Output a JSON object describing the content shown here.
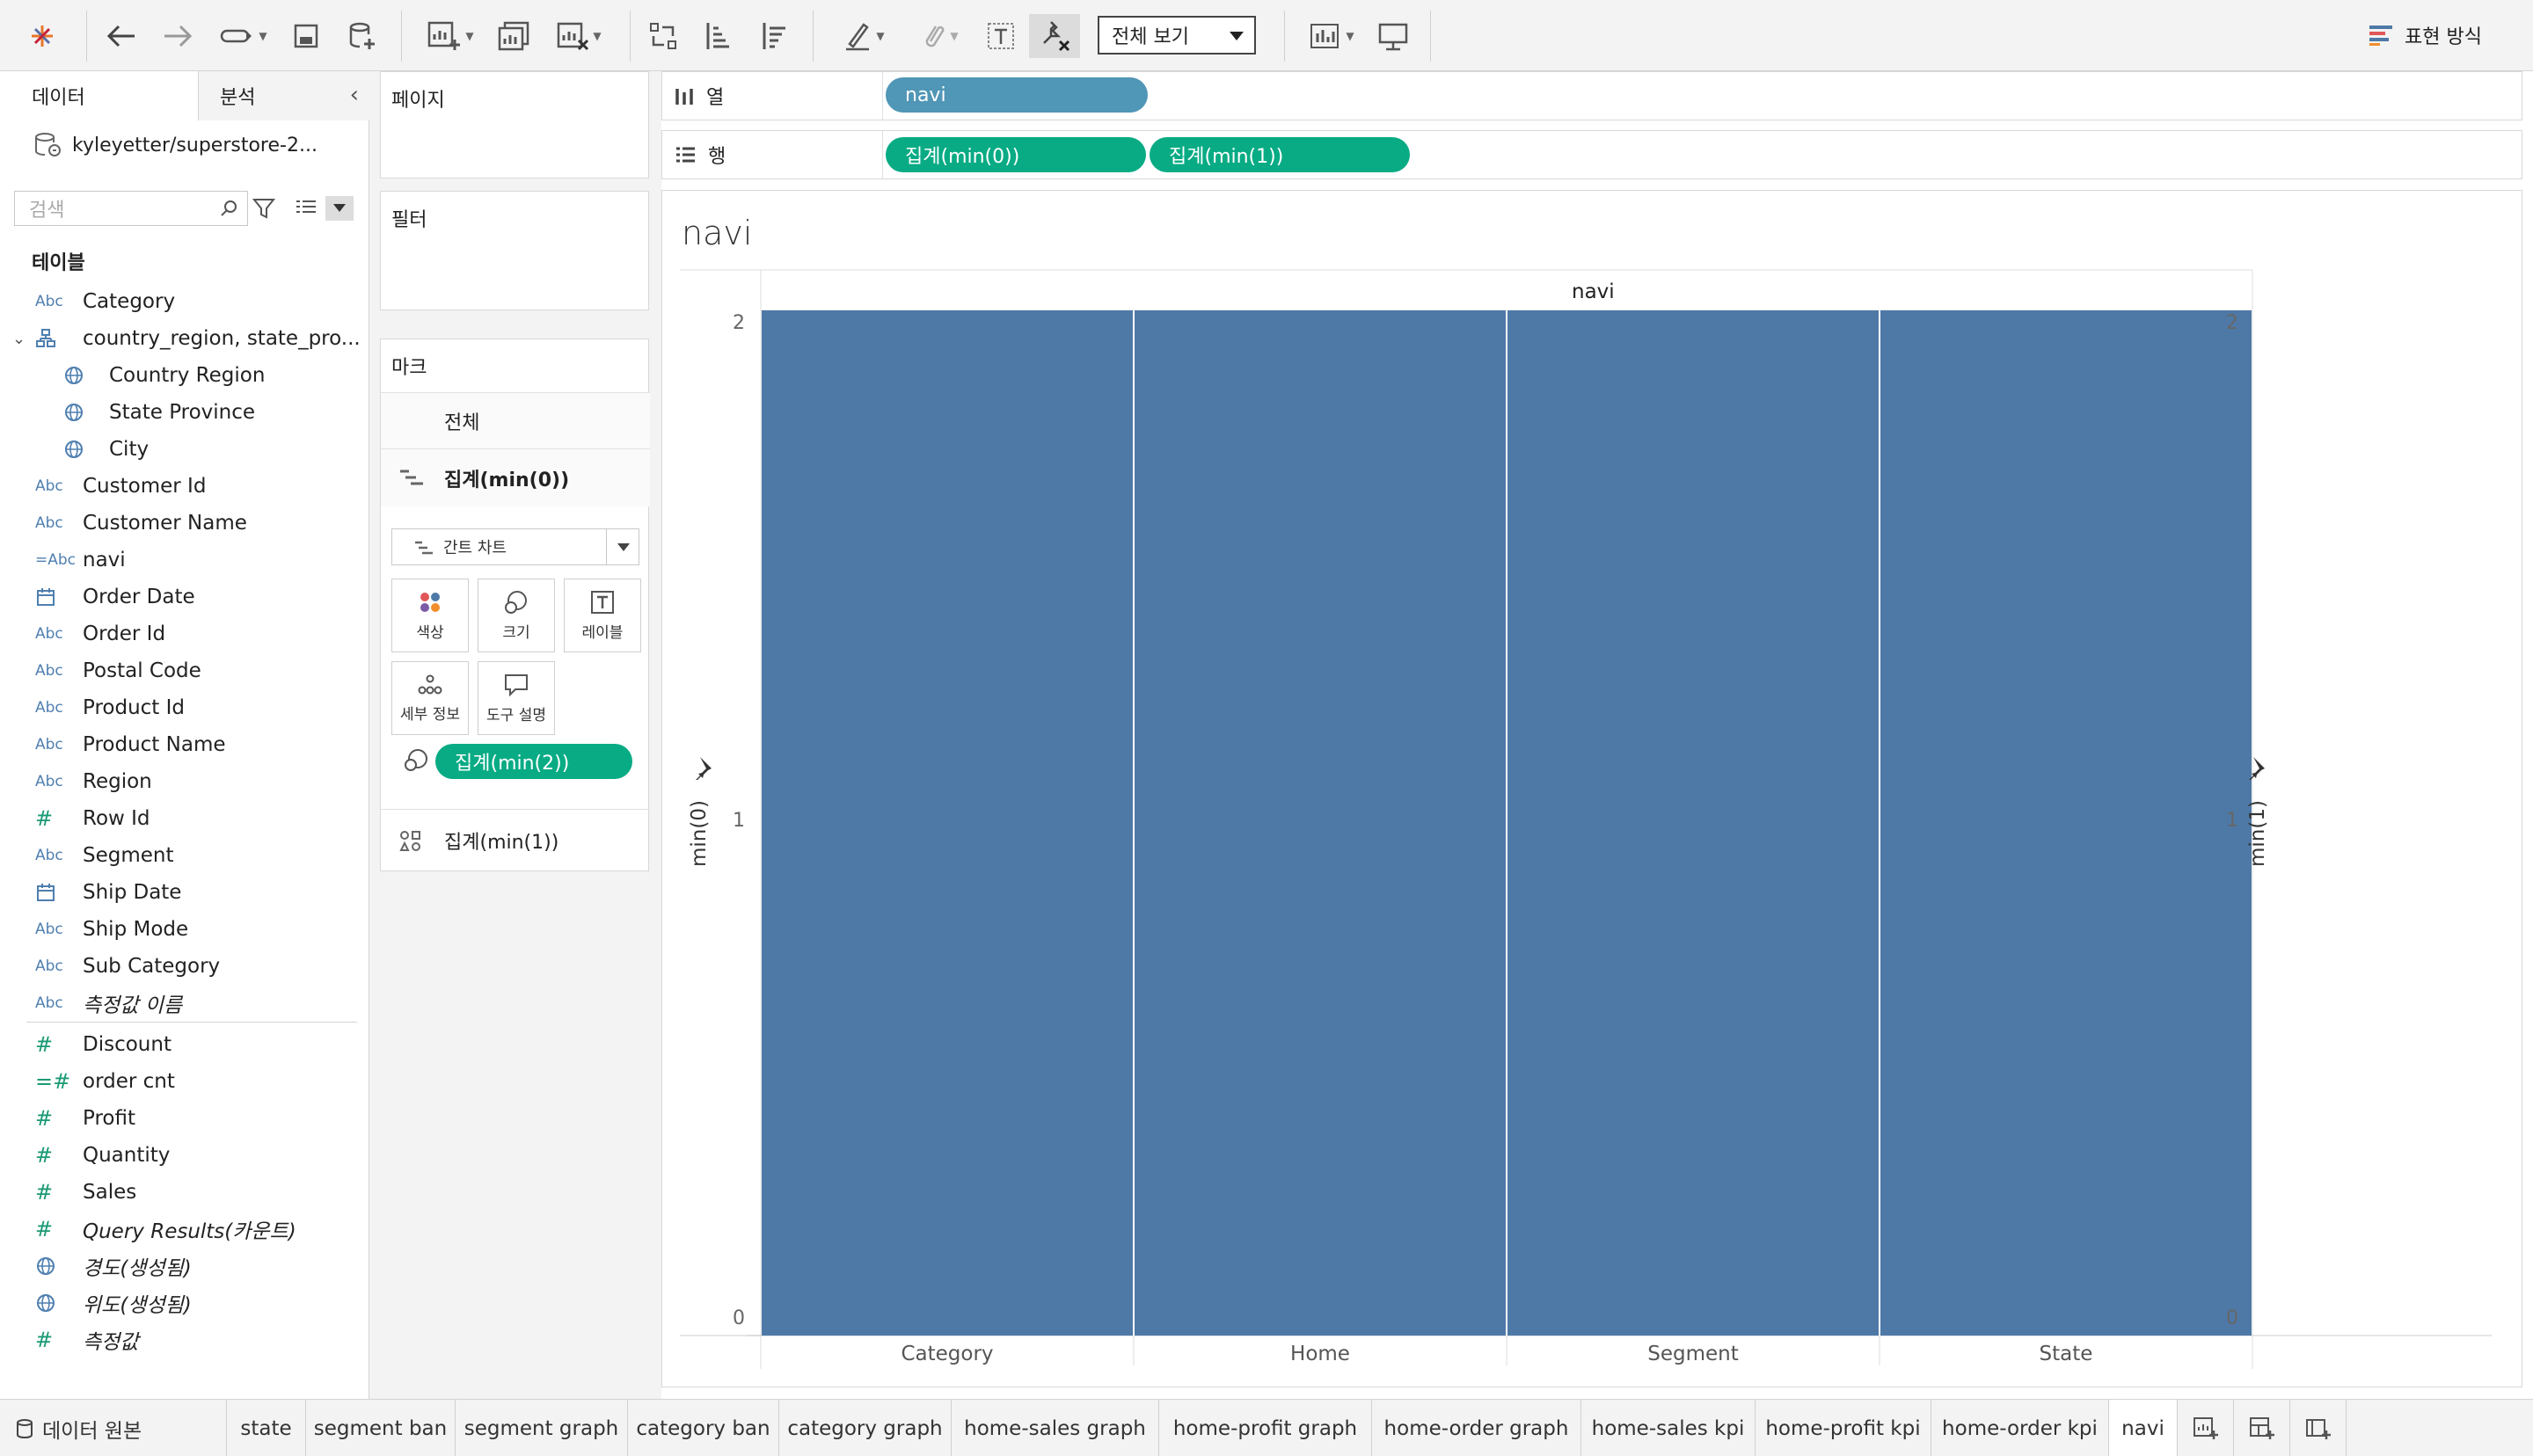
{
  "toolbar": {
    "view_select": "전체 보기",
    "show_me": "표현 방식"
  },
  "data_pane": {
    "tab_data": "데이터",
    "tab_analysis": "분석",
    "datasource": "kyleyetter/superstore-2...",
    "search_placeholder": "검색",
    "tables_heading": "테이블",
    "fields": [
      {
        "icon": "Abc",
        "name": "Category"
      },
      {
        "icon": "hierarchy",
        "name": "country_region, state_pro..."
      },
      {
        "icon": "globe",
        "name": "Country Region"
      },
      {
        "icon": "globe",
        "name": "State Province"
      },
      {
        "icon": "globe",
        "name": "City"
      },
      {
        "icon": "Abc",
        "name": "Customer Id"
      },
      {
        "icon": "Abc",
        "name": "Customer Name"
      },
      {
        "icon": "=Abc",
        "name": "navi"
      },
      {
        "icon": "calendar",
        "name": "Order Date"
      },
      {
        "icon": "Abc",
        "name": "Order Id"
      },
      {
        "icon": "Abc",
        "name": "Postal Code"
      },
      {
        "icon": "Abc",
        "name": "Product Id"
      },
      {
        "icon": "Abc",
        "name": "Product Name"
      },
      {
        "icon": "Abc",
        "name": "Region"
      },
      {
        "icon": "#",
        "name": "Row Id"
      },
      {
        "icon": "Abc",
        "name": "Segment"
      },
      {
        "icon": "calendar",
        "name": "Ship Date"
      },
      {
        "icon": "Abc",
        "name": "Ship Mode"
      },
      {
        "icon": "Abc",
        "name": "Sub Category"
      },
      {
        "icon": "Abc",
        "name": "측정값 이름"
      }
    ],
    "measures": [
      {
        "icon": "#",
        "name": "Discount"
      },
      {
        "icon": "=#",
        "name": "order cnt"
      },
      {
        "icon": "#",
        "name": "Profit"
      },
      {
        "icon": "#",
        "name": "Quantity"
      },
      {
        "icon": "#",
        "name": "Sales"
      },
      {
        "icon": "#",
        "name": "Query Results(카운트)"
      },
      {
        "icon": "globe",
        "name": "경도(생성됨)"
      },
      {
        "icon": "globe",
        "name": "위도(생성됨)"
      },
      {
        "icon": "#",
        "name": "측정값"
      }
    ]
  },
  "cards": {
    "pages": "페이지",
    "filters": "필터",
    "marks": "마크",
    "marks_all": "전체",
    "marks_agg0": "집계(min(0))",
    "mark_type": "간트 차트",
    "btn_color": "색상",
    "btn_size": "크기",
    "btn_label": "레이블",
    "btn_detail": "세부 정보",
    "btn_tooltip": "도구 설명",
    "size_pill": "집계(min(2))",
    "marks_agg1": "집계(min(1))"
  },
  "shelves": {
    "columns_label": "열",
    "rows_label": "행",
    "columns_pill": "navi",
    "rows_pill_1": "집계(min(0))",
    "rows_pill_2": "집계(min(1))"
  },
  "viz": {
    "title": "navi",
    "column_header": "navi",
    "left_axis_title": "min(0)",
    "right_axis_title": "min(1)",
    "y_ticks": [
      "2",
      "1",
      "0"
    ],
    "bar_color": "#4e79a7"
  },
  "chart_data": {
    "type": "bar",
    "title": "navi",
    "categories": [
      "Category",
      "Home",
      "Segment",
      "State"
    ],
    "series": [
      {
        "name": "min(0)",
        "values": [
          2,
          2,
          2,
          2
        ]
      }
    ],
    "xlabel": "navi",
    "ylabel": "min(0)",
    "ylim": [
      0,
      2
    ],
    "y2label": "min(1)",
    "y2lim": [
      0,
      2
    ]
  },
  "sheet_tabs": {
    "datasource": "데이터 원본",
    "tabs": [
      "state",
      "segment ban",
      "segment graph",
      "category ban",
      "category graph",
      "home-sales graph",
      "home-profit graph",
      "home-order graph",
      "home-sales kpi",
      "home-profit kpi",
      "home-order kpi",
      "navi"
    ],
    "active": "navi"
  }
}
